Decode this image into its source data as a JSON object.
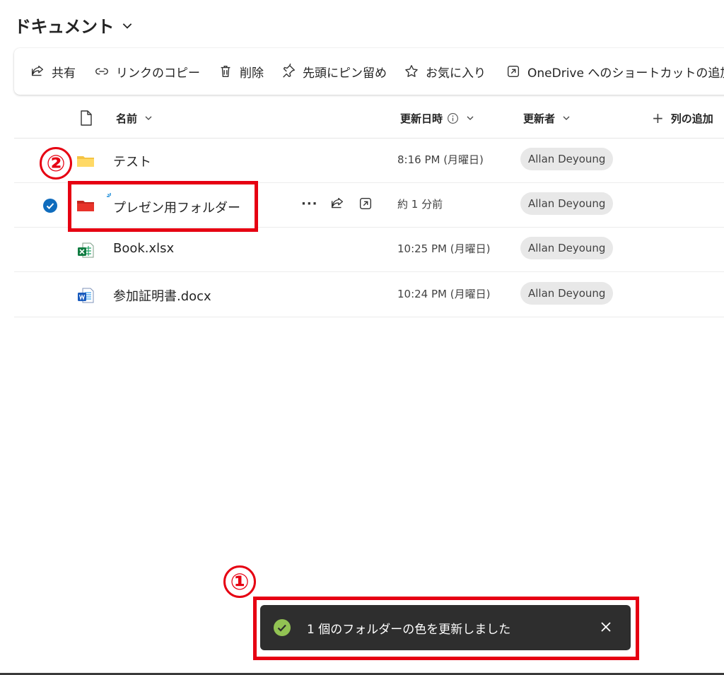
{
  "header": {
    "title": "ドキュメント"
  },
  "command_bar": {
    "share": "共有",
    "copy_link": "リンクのコピー",
    "delete": "削除",
    "pin_to_top": "先頭にピン留め",
    "favorite": "お気に入り",
    "add_shortcut": "OneDrive へのショートカットの追加"
  },
  "columns": {
    "name": "名前",
    "modified": "更新日時",
    "modified_by": "更新者",
    "add_column": "列の追加"
  },
  "files": [
    {
      "name": "テスト",
      "type": "folder",
      "color": "#f5c342",
      "modified": "8:16 PM (月曜日)",
      "modified_by": "Allan Deyoung",
      "selected": false
    },
    {
      "name": "プレゼン用フォルダー",
      "type": "folder",
      "color": "#e8332a",
      "modified": "約 1 分前",
      "modified_by": "Allan Deyoung",
      "selected": true
    },
    {
      "name": "Book.xlsx",
      "type": "excel",
      "modified": "10:25 PM (月曜日)",
      "modified_by": "Allan Deyoung",
      "selected": false
    },
    {
      "name": "参加証明書.docx",
      "type": "word",
      "modified": "10:24 PM (月曜日)",
      "modified_by": "Allan Deyoung",
      "selected": false
    }
  ],
  "row_actions": {
    "more": "···"
  },
  "toast": {
    "message": "1 個のフォルダーの色を更新しました",
    "status": "success"
  },
  "annotations": {
    "first": "①",
    "second": "②"
  },
  "colors": {
    "accent": "#0f6cbd",
    "annotation": "#e60012",
    "toast_bg": "#2e2e2e",
    "toast_ok": "#92c353"
  }
}
